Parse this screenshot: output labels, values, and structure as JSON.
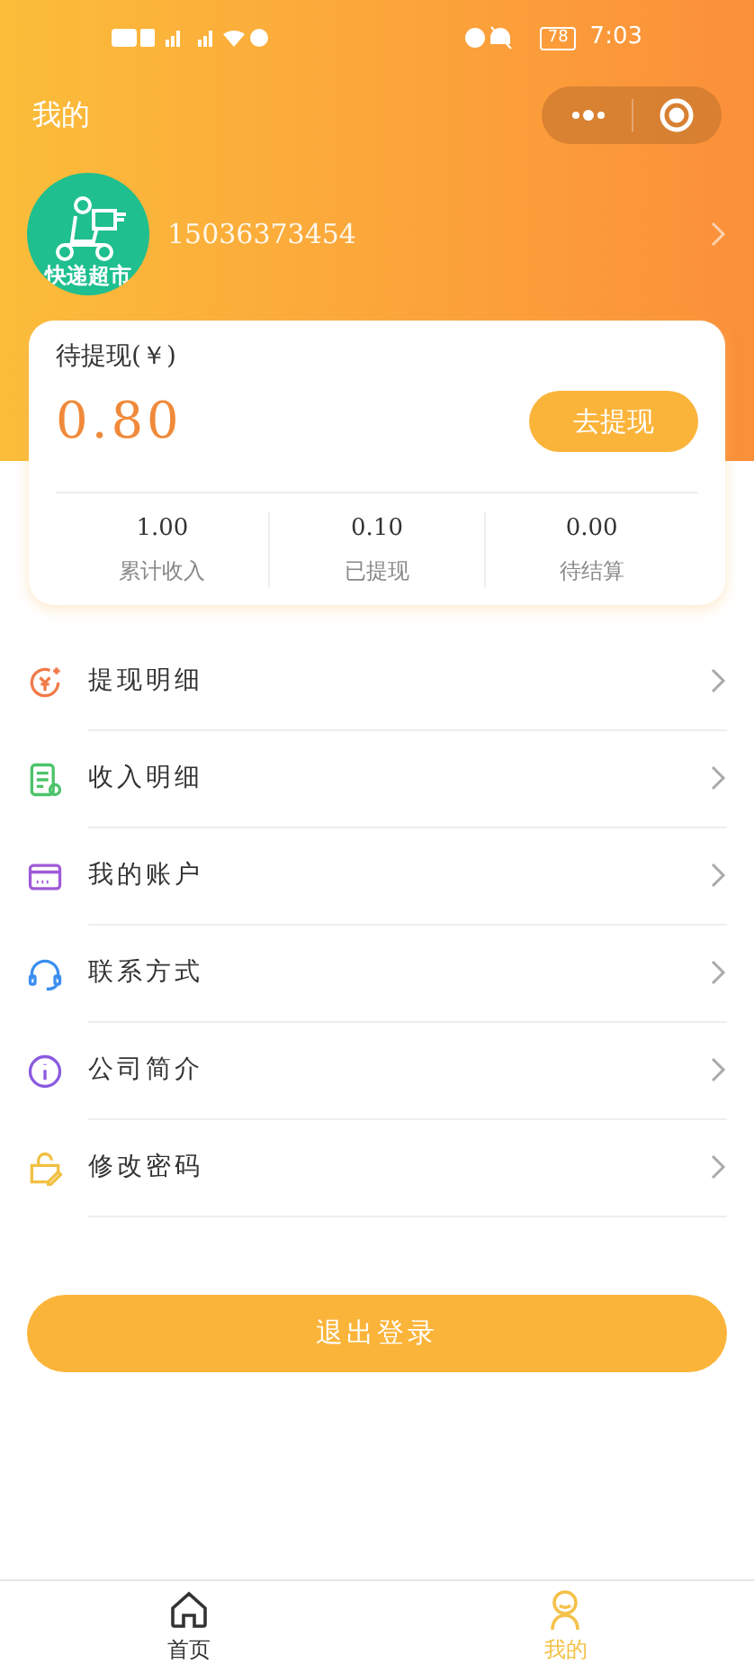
{
  "status_bar": {
    "battery": "78",
    "time": "7:03"
  },
  "header": {
    "title": "我的"
  },
  "profile": {
    "avatar_caption": "快递超市",
    "phone": "15036373454"
  },
  "balance_card": {
    "label": "待提现(￥)",
    "amount": "0.80",
    "button": "去提现",
    "stats": [
      {
        "value": "1.00",
        "label": "累计收入"
      },
      {
        "value": "0.10",
        "label": "已提现"
      },
      {
        "value": "0.00",
        "label": "待结算"
      }
    ]
  },
  "menu": [
    {
      "kind": "withdraw",
      "label": "提现明细"
    },
    {
      "kind": "income",
      "label": "收入明细"
    },
    {
      "kind": "account",
      "label": "我的账户"
    },
    {
      "kind": "contact",
      "label": "联系方式"
    },
    {
      "kind": "about",
      "label": "公司简介"
    },
    {
      "kind": "password",
      "label": "修改密码"
    }
  ],
  "logout_button": "退出登录",
  "tab_bar": [
    {
      "kind": "home",
      "label": "首页",
      "selected": false
    },
    {
      "kind": "me",
      "label": "我的",
      "selected": true
    }
  ]
}
